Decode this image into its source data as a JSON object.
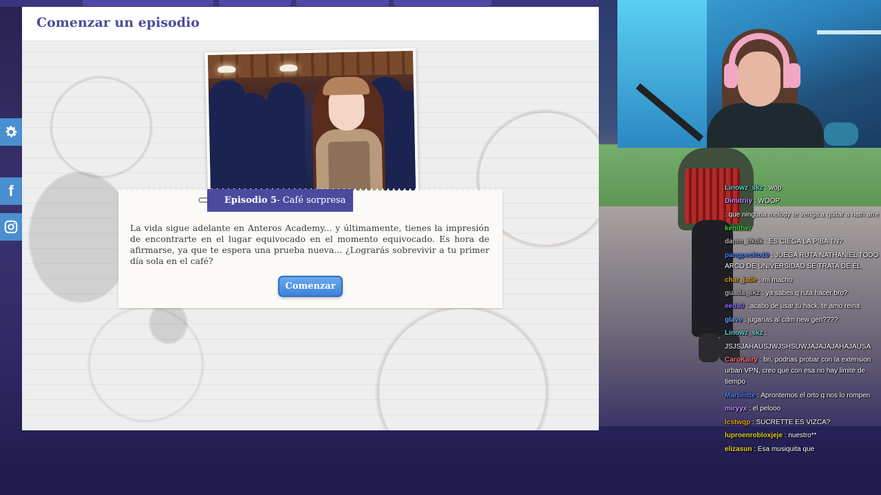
{
  "panel": {
    "title": "Comenzar un episodio",
    "episode_number": "Episodio 5",
    "episode_name": " - Café sorpresa",
    "description": "La vida sigue adelante en Anteros Academy... y últimamente, tienes la impresión de encontrarte en el lugar equivocado en el momento equivocado. Es hora de afirmarse, ya que te espera una prueba nueva... ¿Lograrás sobrevivir a tu primer día sola en el café?",
    "start_button": "Comenzar"
  },
  "sidebar": {
    "settings_icon": "gear-icon",
    "facebook_label": "f",
    "instagram_icon": "instagram-icon"
  },
  "chat": {
    "messages": [
      {
        "user": "Linowz_skz",
        "color": "#5fd3d3",
        "text": "wop"
      },
      {
        "user": "Dimitriiy",
        "color": "#c48bff",
        "text": "WOOP"
      },
      {
        "user": "",
        "color": "#e03030",
        "text": ": que ninguna melody te venga a quitar a nath arre"
      },
      {
        "user": "kenither",
        "color": "#3cd23c",
        "text": ""
      },
      {
        "user": "danm_bkdk",
        "color": "#b0b0b0",
        "text": "ES CIEGA LA PIBA TN?"
      },
      {
        "user": "pangpecito19",
        "color": "#4a7cff",
        "text": "JUEGA RUTA NATHANIEL TODO ARCO DE UNIVERSIDAD SE TRATA DE ÉL"
      },
      {
        "user": "char_jade",
        "color": "#e0a020",
        "text": "mi macho"
      },
      {
        "user": "guada_skz",
        "color": "#b0b0b0",
        "text": "ya sabes q ruta hacer bro?"
      },
      {
        "user": "eeds0",
        "color": "#8a6bff",
        "text": "acabo de usar tu hack, te amo reina"
      },
      {
        "user": "glave",
        "color": "#5fa0ff",
        "text": "jugarías al cdm new gen????"
      },
      {
        "user": "Linowz_skz",
        "color": "#5fd3d3",
        "text": "JSJSJAHAUSJWJSHSUWJAJAJAJAHAJAUSA"
      },
      {
        "user": "CaroKairy",
        "color": "#ff6a6a",
        "text": "bri, podrias probar con la extension urban VPN, creo que con esa no hay limite de tiempo"
      },
      {
        "user": "",
        "color": "#e03030",
        "text": ""
      },
      {
        "user": "Martiiiitte",
        "color": "#4a7cff",
        "text": "Aprontemos el orto q nos lo rompen"
      },
      {
        "user": "miryyx",
        "color": "#c48bff",
        "text": "el pelooo"
      },
      {
        "user": "lcstwqp",
        "color": "#e0a020",
        "text": "SUCRETTE ES VIZCA?"
      },
      {
        "user": "luproenrobloxjeje",
        "color": "#e0d020",
        "text": "nuestro**"
      },
      {
        "user": "elizasun",
        "color": "#e0d020",
        "text": "Esa musiquita que"
      }
    ]
  }
}
